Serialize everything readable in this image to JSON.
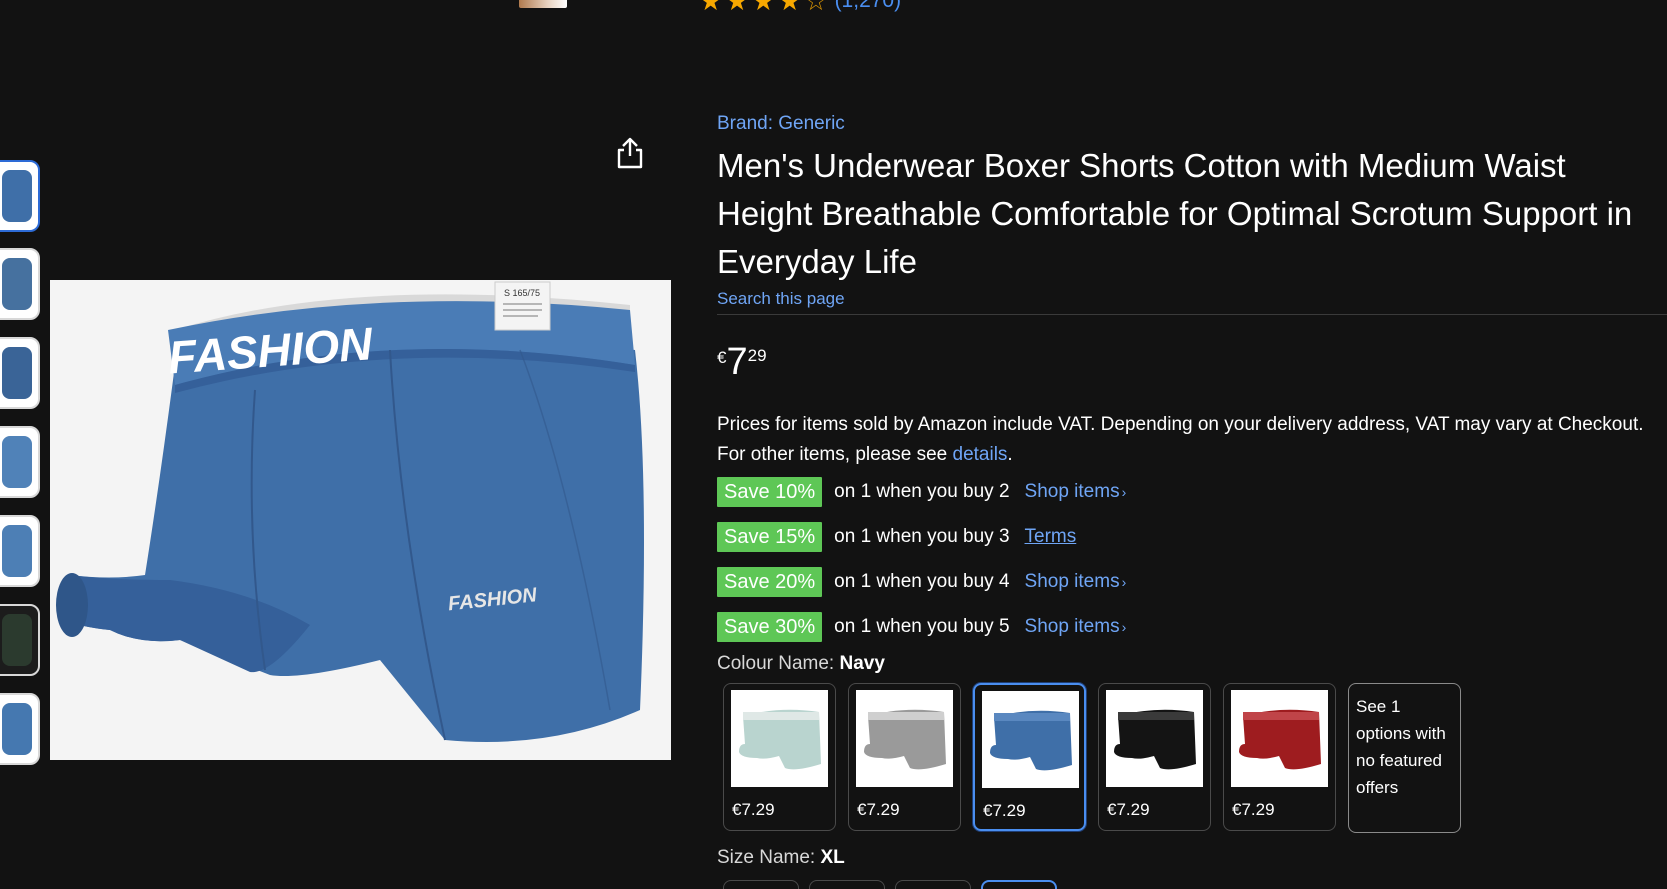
{
  "top": {
    "rating_count": "(1,270)",
    "star_icons": [
      "star-full",
      "star-full",
      "star-full",
      "star-full",
      "star-half"
    ]
  },
  "thumbnails": [
    {
      "name": "thumb-1",
      "selected": true
    },
    {
      "name": "thumb-2",
      "selected": false
    },
    {
      "name": "thumb-3",
      "selected": false
    },
    {
      "name": "thumb-4",
      "selected": false
    },
    {
      "name": "thumb-5",
      "selected": false
    },
    {
      "name": "thumb-6",
      "selected": false
    },
    {
      "name": "thumb-7",
      "selected": false
    }
  ],
  "main_image": {
    "waistband_text": "FASHION",
    "leg_text": "FASHION",
    "tag_text": "S 165/75"
  },
  "product": {
    "brand": "Brand: Generic",
    "title": "Men's Underwear Boxer Shorts Cotton with Medium Waist Height Breathable Comfortable for Optimal Scrotum Support in Everyday Life",
    "search_link": "Search this page",
    "price": {
      "currency": "€",
      "whole": "7",
      "fraction": "29"
    },
    "vat_text": "Prices for items sold by Amazon include VAT. Depending on your delivery address, VAT may vary at Checkout. For other items, please see ",
    "vat_link": "details",
    "vat_end": "."
  },
  "promos": [
    {
      "badge": "Save 10%",
      "text": "on 1 when you buy 2",
      "link": "Shop items",
      "chevron": "›"
    },
    {
      "badge": "Save 15%",
      "text": "on 1 when you buy 3",
      "link": "Terms",
      "chevron": ""
    },
    {
      "badge": "Save 20%",
      "text": "on 1 when you buy 4",
      "link": "Shop items",
      "chevron": "›"
    },
    {
      "badge": "Save 30%",
      "text": "on 1 when you buy 5",
      "link": "Shop items",
      "chevron": "›"
    }
  ],
  "colour": {
    "label": "Colour Name:",
    "value": "Navy",
    "options": [
      {
        "price": "€7.29",
        "color": "#b9d4cf",
        "selected": false
      },
      {
        "price": "€7.29",
        "color": "#9a9a9a",
        "selected": false
      },
      {
        "price": "€7.29",
        "color": "#3f6fa8",
        "selected": true
      },
      {
        "price": "€7.29",
        "color": "#141414",
        "selected": false
      },
      {
        "price": "€7.29",
        "color": "#9e1c1f",
        "selected": false
      }
    ],
    "see_more": "See 1 options with no featured offers"
  },
  "size": {
    "label": "Size Name:",
    "value": "XL"
  },
  "colors": {
    "background": "#121212",
    "link": "#6fa5f5",
    "badge": "#5ec756",
    "selected_border": "#4a8ef0",
    "product_blue": "#3f6fa8"
  }
}
